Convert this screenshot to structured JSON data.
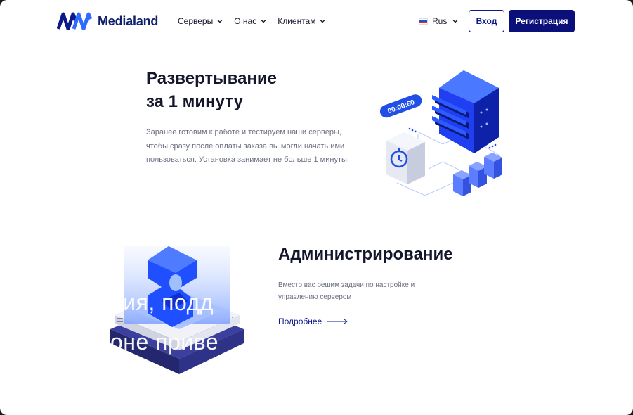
{
  "header": {
    "brand": "Medialand",
    "nav": [
      {
        "label": "Серверы"
      },
      {
        "label": "О нас"
      },
      {
        "label": "Клиентам"
      }
    ],
    "lang": "Rus",
    "login_label": "Вход",
    "register_label": "Регистрация"
  },
  "deploy": {
    "title_line1": "Развертывание",
    "title_line2": "за 1 минуту",
    "text": "Заранее готовим к работе и тестируем наши серверы, чтобы сразу после оплаты заказа вы могли начать ими пользоваться. Установка занимает не больше 1 минуты.",
    "timer": "00:00:60"
  },
  "admin": {
    "title": "Администрирование",
    "text": "Вместо вас решим задачи по настройке и управлению сервером",
    "more_label": "Подробнее"
  },
  "overlay": {
    "line1": "ния, подд",
    "line2": "оне приве"
  },
  "colors": {
    "brand_dark": "#0a0f7a",
    "accent_blue": "#1f5cff",
    "text_dark": "#14162b",
    "text_muted": "#6b6f80"
  }
}
